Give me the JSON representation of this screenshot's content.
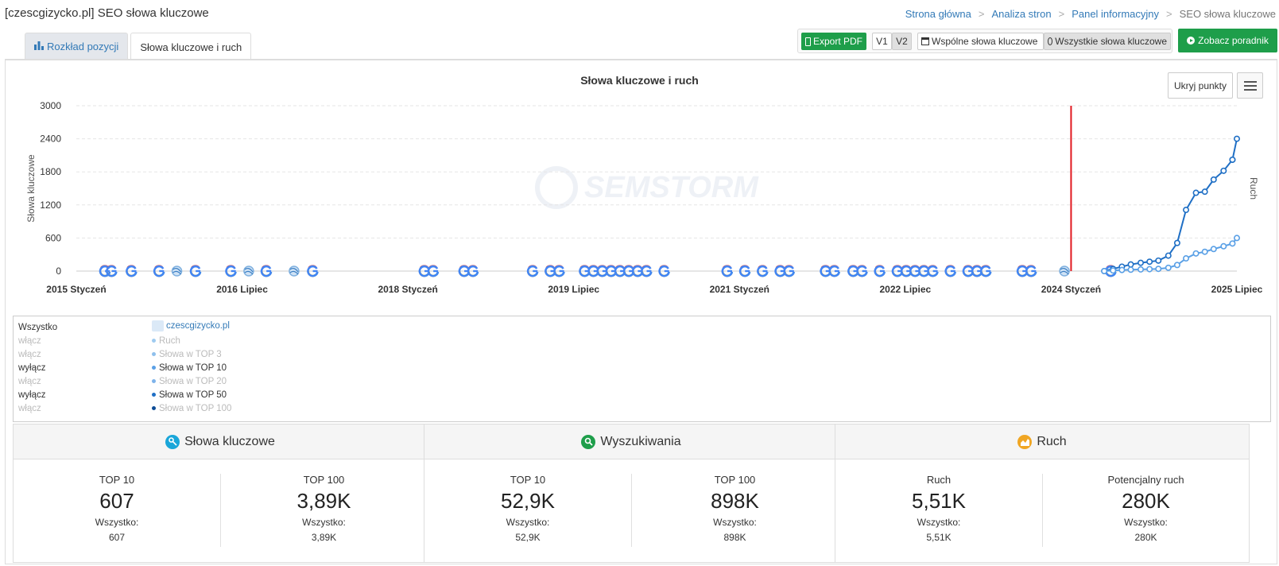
{
  "page": {
    "title": "[czescgizycko.pl] SEO słowa kluczowe"
  },
  "breadcrumb": {
    "items": [
      "Strona główna",
      "Analiza stron",
      "Panel informacyjny"
    ],
    "current": "SEO słowa kluczowe"
  },
  "tabs": [
    {
      "label": "Rozkład pozycji",
      "icon": "bar-chart-icon",
      "active": false
    },
    {
      "label": "Słowa kluczowe i ruch",
      "active": true
    }
  ],
  "toolbar": {
    "export_pdf": "Export PDF",
    "v1": "V1",
    "v2": "V2",
    "common_keywords": "Wspólne słowa kluczowe",
    "all_keywords": "Wszystkie słowa kluczowe",
    "guide": "Zobacz poradnik"
  },
  "chart_controls": {
    "hide_points": "Ukryj punkty"
  },
  "chart_data": {
    "type": "line",
    "title": "Słowa kluczowe i ruch",
    "ylabel": "Słowa kluczowe",
    "ylabel_right": "Ruch",
    "watermark": "SEMSTORM",
    "ylim": [
      0,
      3000
    ],
    "yticks": [
      0,
      600,
      1200,
      1800,
      2400,
      3000
    ],
    "grid": true,
    "x_tick_labels": [
      "2015 Styczeń",
      "2016 Lipiec",
      "2018 Styczeń",
      "2019 Lipiec",
      "2021 Styczeń",
      "2022 Lipiec",
      "2024 Styczeń",
      "2025 Lipiec"
    ],
    "x_tick_values": [
      2015.0,
      2016.5,
      2018.0,
      2019.5,
      2021.0,
      2022.5,
      2024.0,
      2025.5
    ],
    "marker_line_x": 2024.0,
    "marker_line_color": "#e0191f",
    "series": [
      {
        "color": "#1f6fc5",
        "x": [
          2024.3,
          2024.38,
          2024.46,
          2024.54,
          2024.63,
          2024.71,
          2024.79,
          2024.88,
          2024.96,
          2025.04,
          2025.13,
          2025.21,
          2025.29,
          2025.38,
          2025.46
        ],
        "y": [
          0,
          40,
          80,
          120,
          150,
          170,
          190,
          280,
          510,
          1110,
          1420,
          1440,
          1660,
          1820,
          2020
        ]
      },
      {
        "color": "#1f6fc5",
        "x": [
          2025.46,
          2025.5
        ],
        "y": [
          2020,
          2400
        ]
      },
      {
        "color": "#5aa0e6",
        "x": [
          2024.3,
          2024.38,
          2024.46,
          2024.54,
          2024.63,
          2024.71,
          2024.79,
          2024.88,
          2024.96,
          2025.04,
          2025.13,
          2025.21,
          2025.29,
          2025.38,
          2025.46,
          2025.5
        ],
        "y": [
          0,
          10,
          20,
          25,
          30,
          35,
          40,
          60,
          110,
          230,
          320,
          350,
          400,
          450,
          500,
          600
        ]
      }
    ],
    "events": {
      "google": [
        2015.26,
        2015.32,
        2015.5,
        2015.75,
        2016.08,
        2016.4,
        2016.72,
        2017.14,
        2018.15,
        2018.23,
        2018.51,
        2018.59,
        2019.13,
        2019.29,
        2019.37,
        2019.6,
        2019.68,
        2019.76,
        2019.84,
        2019.92,
        2020.0,
        2020.08,
        2020.16,
        2020.32,
        2020.89,
        2021.05,
        2021.21,
        2021.37,
        2021.45,
        2021.78,
        2021.86,
        2022.03,
        2022.11,
        2022.27,
        2022.43,
        2022.51,
        2022.59,
        2022.67,
        2022.75,
        2022.91,
        2023.07,
        2023.15,
        2023.23,
        2023.56,
        2023.64,
        2024.36
      ],
      "algo": [
        2015.91,
        2016.56,
        2016.97,
        2023.94
      ]
    }
  },
  "legend": {
    "site": "czescgizycko.pl",
    "all_label": "Wszystko",
    "rows": [
      {
        "toggle": "włącz",
        "label": "Ruch",
        "active": false,
        "color": "#9ecbf0"
      },
      {
        "toggle": "włącz",
        "label": "Słowa w TOP 3",
        "active": false,
        "color": "#8fc0ec"
      },
      {
        "toggle": "wyłącz",
        "label": "Słowa w TOP 10",
        "active": true,
        "color": "#5aa0e6"
      },
      {
        "toggle": "włącz",
        "label": "Słowa w TOP 20",
        "active": false,
        "color": "#7eb3ea"
      },
      {
        "toggle": "wyłącz",
        "label": "Słowa w TOP 50",
        "active": true,
        "color": "#1f6fc5"
      },
      {
        "toggle": "włącz",
        "label": "Słowa w TOP 100",
        "active": false,
        "color": "#0d4c96"
      }
    ]
  },
  "cards": [
    {
      "title": "Słowa kluczowe",
      "icon": "key-icon",
      "icon_color": "#1aa6d9",
      "left": {
        "label": "TOP 10",
        "value": "607",
        "all_label": "Wszystko:",
        "all_value": "607"
      },
      "right": {
        "label": "TOP 100",
        "value": "3,89K",
        "all_label": "Wszystko:",
        "all_value": "3,89K"
      }
    },
    {
      "title": "Wyszukiwania",
      "icon": "search-icon",
      "icon_color": "#1e9e4a",
      "left": {
        "label": "TOP 10",
        "value": "52,9K",
        "all_label": "Wszystko:",
        "all_value": "52,9K"
      },
      "right": {
        "label": "TOP 100",
        "value": "898K",
        "all_label": "Wszystko:",
        "all_value": "898K"
      }
    },
    {
      "title": "Ruch",
      "icon": "area-chart-icon",
      "icon_color": "#f0a623",
      "left": {
        "label": "Ruch",
        "value": "5,51K",
        "all_label": "Wszystko:",
        "all_value": "5,51K"
      },
      "right": {
        "label": "Potencjalny ruch",
        "value": "280K",
        "all_label": "Wszystko:",
        "all_value": "280K"
      }
    }
  ]
}
